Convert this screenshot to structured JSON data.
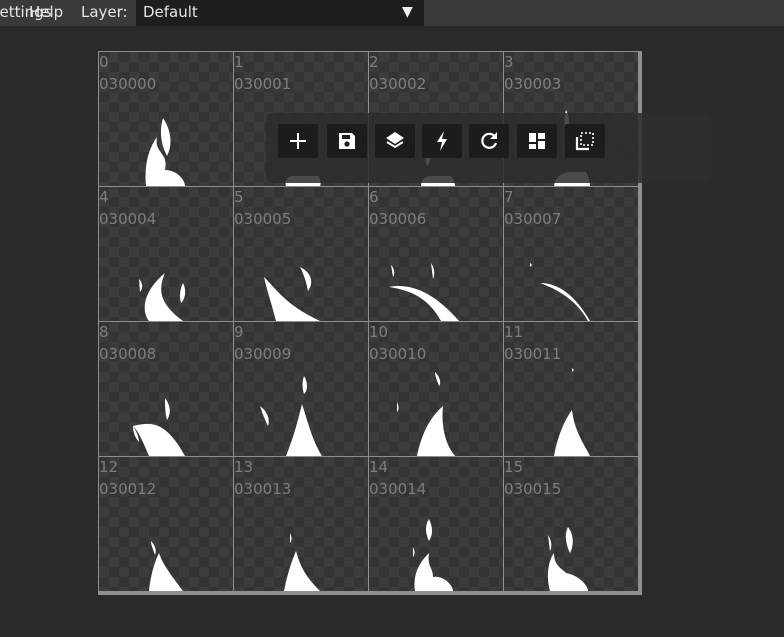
{
  "menubar": {
    "settings_label": "Settings",
    "help_label": "Help",
    "layer_label": "Layer:",
    "layer_value": "Default"
  },
  "toolbar": {
    "buttons": [
      "add-icon",
      "save-icon",
      "layers-icon",
      "lightning-icon",
      "refresh-icon",
      "layout-icon",
      "selection-icon"
    ]
  },
  "frames": [
    {
      "index": "0",
      "code": "030000"
    },
    {
      "index": "1",
      "code": "030001"
    },
    {
      "index": "2",
      "code": "030002"
    },
    {
      "index": "3",
      "code": "030003"
    },
    {
      "index": "4",
      "code": "030004"
    },
    {
      "index": "5",
      "code": "030005"
    },
    {
      "index": "6",
      "code": "030006"
    },
    {
      "index": "7",
      "code": "030007"
    },
    {
      "index": "8",
      "code": "030008"
    },
    {
      "index": "9",
      "code": "030009"
    },
    {
      "index": "10",
      "code": "030010"
    },
    {
      "index": "11",
      "code": "030011"
    },
    {
      "index": "12",
      "code": "030012"
    },
    {
      "index": "13",
      "code": "030013"
    },
    {
      "index": "14",
      "code": "030014"
    },
    {
      "index": "15",
      "code": "030015"
    }
  ]
}
